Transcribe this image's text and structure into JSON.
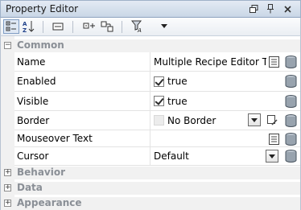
{
  "window": {
    "title": "Property Editor"
  },
  "categories": {
    "common": "Common",
    "behavior": "Behavior",
    "data": "Data",
    "appearance": "Appearance"
  },
  "expanders": {
    "common": "−",
    "behavior": "+",
    "data": "+",
    "appearance": "+"
  },
  "properties": [
    {
      "name": "Name",
      "value": "Multiple Recipe Editor Table"
    },
    {
      "name": "Enabled",
      "value": "true",
      "checked": true
    },
    {
      "name": "Visible",
      "value": "true",
      "checked": true
    },
    {
      "name": "Border",
      "value": "No Border"
    },
    {
      "name": "Mouseover Text",
      "value": ""
    },
    {
      "name": "Cursor",
      "value": "Default"
    }
  ],
  "icons": {
    "toolbar": [
      "categorized-view-icon",
      "alphabetical-sort-icon",
      "property-panel-icon",
      "binding-add-icon",
      "binding-remove-icon",
      "filter-icon",
      "dropdown-arrow-icon"
    ],
    "row": [
      "text-editor-icon",
      "database-binding-icon",
      "edit-icon"
    ]
  },
  "colors": {
    "titlebar": "#d3deeb",
    "category_text": "#8a8f96",
    "grid_line": "#e3e3e3"
  }
}
